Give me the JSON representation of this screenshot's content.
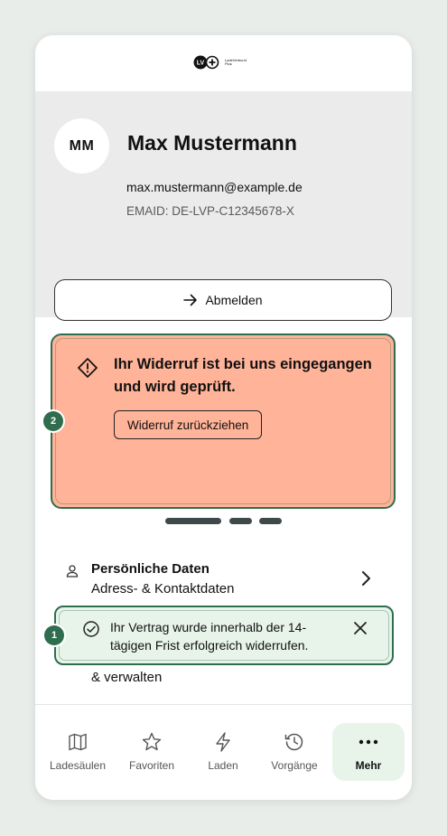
{
  "brand": {
    "logo_mark": "LV",
    "logo_line1": "LadeVerbund",
    "logo_line2": "Plus",
    "accent": "#2f6d4e"
  },
  "profile": {
    "initials": "MM",
    "name": "Max Mustermann",
    "email": "max.mustermann@example.de",
    "emaid": "EMAID: DE-LVP-C12345678-X",
    "logout_label": "Abmelden"
  },
  "alert": {
    "text": "Ihr Widerruf ist bei uns eingegangen und wird geprüft.",
    "button_label": "Widerruf zurückziehen",
    "badge": "2",
    "color": "#ffb398"
  },
  "list": {
    "items": [
      {
        "title": "Persönliche Daten",
        "subtitle": "Adress- & Kontaktdaten"
      }
    ],
    "partial_text": "& verwalten"
  },
  "toast": {
    "text": "Ihr Vertrag wurde innerhalb der 14-tägigen Frist erfolgreich widerrufen.",
    "badge": "1",
    "color": "#e8f4ea"
  },
  "nav": {
    "items": [
      {
        "label": "Ladesäulen",
        "icon": "map-icon"
      },
      {
        "label": "Favoriten",
        "icon": "star-icon"
      },
      {
        "label": "Laden",
        "icon": "lightning-icon"
      },
      {
        "label": "Vorgänge",
        "icon": "history-icon"
      },
      {
        "label": "Mehr",
        "icon": "more-icon",
        "active": true
      }
    ]
  }
}
